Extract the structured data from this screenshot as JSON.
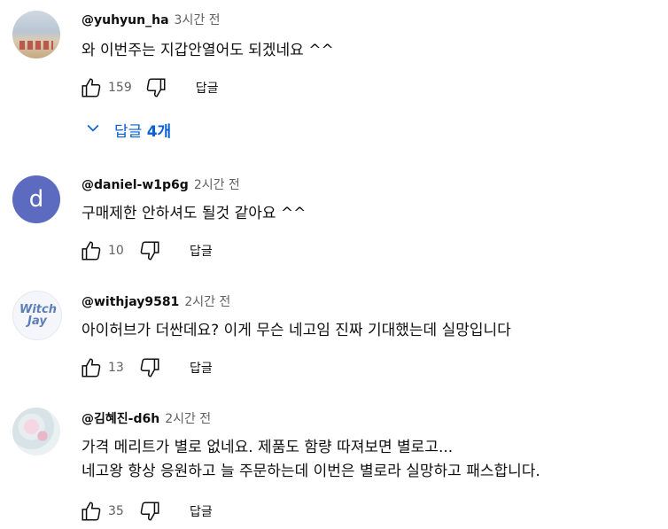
{
  "comments": [
    {
      "author": "@yuhyun_ha",
      "time": "3시간 전",
      "lines": [
        "와 이번주는 지갑안열어도 되겠네요 ^^"
      ],
      "likes": "159",
      "reply_label": "답글",
      "replies_label": "답글",
      "replies_count": "4개"
    },
    {
      "author": "@daniel-w1p6g",
      "time": "2시간 전",
      "avatar_letter": "d",
      "lines": [
        "구매제한 안하셔도 될것 같아요 ^^"
      ],
      "likes": "10",
      "reply_label": "답글"
    },
    {
      "author": "@withjay9581",
      "time": "2시간 전",
      "avatar_text": "Witch Jay",
      "lines": [
        "아이허브가 더싼데요? 이게 무슨 네고임 진짜 기대했는데 실망입니다"
      ],
      "likes": "13",
      "reply_label": "답글"
    },
    {
      "author": "@김혜진-d6h",
      "time": "2시간 전",
      "lines": [
        "가격 메리트가 별로 없네요. 제품도 함량 따져보면 별로고...",
        "네고왕 항상 응원하고 늘 주문하는데 이번은 별로라 실망하고 패스합니다."
      ],
      "likes": "35",
      "reply_label": "답글"
    }
  ],
  "icons": {
    "like": "thumbs-up-icon",
    "dislike": "thumbs-down-icon",
    "expand": "chevron-down-icon"
  },
  "colors": {
    "link_blue": "#065fd4",
    "secondary_text": "#606060",
    "avatar_d": "#5c6bc0"
  }
}
